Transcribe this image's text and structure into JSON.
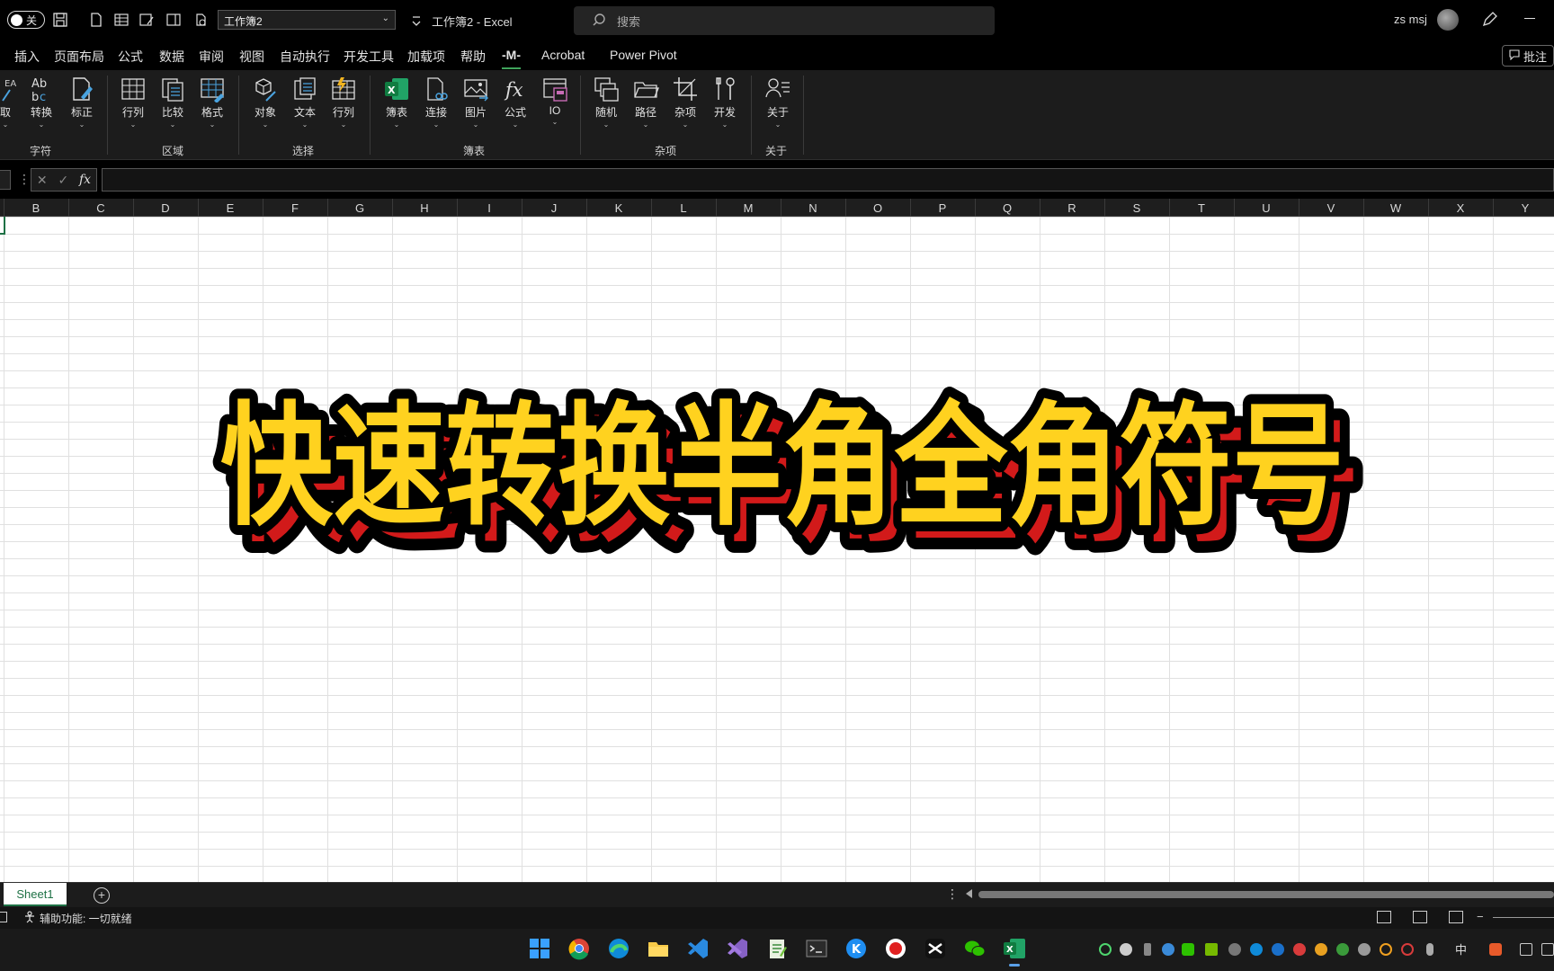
{
  "window": {
    "toggle_label": "关",
    "workbook_select": "工作簿2",
    "title": "工作簿2  -  Excel",
    "search_placeholder": "搜索",
    "user_name": "zs msj"
  },
  "tabs": [
    "插入",
    "页面布局",
    "公式",
    "数据",
    "审阅",
    "视图",
    "自动执行",
    "开发工具",
    "加载项",
    "帮助",
    "-M-",
    "Acrobat",
    "Power Pivot"
  ],
  "active_tab": "-M-",
  "comment_button": "批注",
  "ribbon": {
    "buttons": [
      "取",
      "转换",
      "标正",
      "行列",
      "比较",
      "格式",
      "对象",
      "文本",
      "行列",
      "簿表",
      "连接",
      "图片",
      "公式",
      "IO",
      "随机",
      "路径",
      "杂项",
      "开发",
      "关于"
    ],
    "groups": [
      "字符",
      "区域",
      "选择",
      "簿表",
      "杂项",
      "关于"
    ]
  },
  "formula_bar": {
    "fx": "fx",
    "value": ""
  },
  "columns": [
    "B",
    "C",
    "D",
    "E",
    "F",
    "G",
    "H",
    "I",
    "J",
    "K",
    "L",
    "M",
    "N",
    "O",
    "P",
    "Q",
    "R",
    "S",
    "T",
    "U",
    "V",
    "W",
    "X",
    "Y"
  ],
  "banner_text": "快速转换半角全角符号",
  "sheet": {
    "tab": "Sheet1"
  },
  "status": {
    "accessibility": "辅助功能: 一切就绪"
  },
  "taskbar": {
    "ime": "中"
  },
  "colors": {
    "accent": "#1e7145",
    "banner_fill": "#ffd21f",
    "banner_shadow": "#d21a1a"
  }
}
